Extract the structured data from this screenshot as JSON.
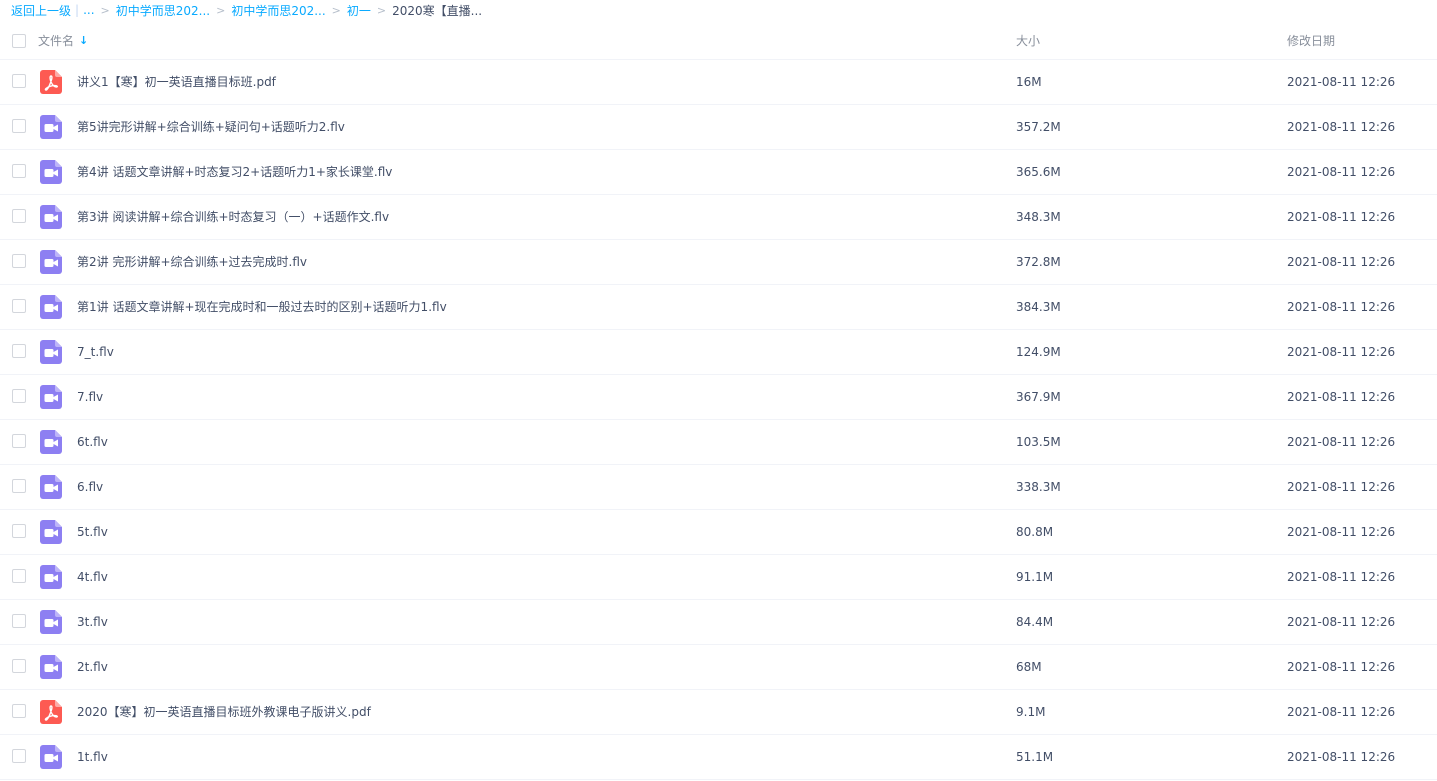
{
  "breadcrumb": {
    "back": "返回上一级",
    "ellipsis": "...",
    "items": [
      "初中学而思202...",
      "初中学而思202...",
      "初一"
    ],
    "current": "2020寒【直播..."
  },
  "header": {
    "name": "文件名",
    "size": "大小",
    "date": "修改日期"
  },
  "colors": {
    "accent": "#09aaff",
    "pdf_icon": "#fd5a52",
    "video_icon": "#8d7ff2"
  },
  "files": [
    {
      "name": "讲义1【寒】初一英语直播目标班.pdf",
      "size": "16M",
      "date": "2021-08-11 12:26",
      "icon": "pdf-icon"
    },
    {
      "name": "第5讲完形讲解+综合训练+疑问句+话题听力2.flv",
      "size": "357.2M",
      "date": "2021-08-11 12:26",
      "icon": "video-icon"
    },
    {
      "name": "第4讲 话题文章讲解+时态复习2+话题听力1+家长课堂.flv",
      "size": "365.6M",
      "date": "2021-08-11 12:26",
      "icon": "video-icon"
    },
    {
      "name": "第3讲 阅读讲解+综合训练+时态复习（一）+话题作文.flv",
      "size": "348.3M",
      "date": "2021-08-11 12:26",
      "icon": "video-icon"
    },
    {
      "name": "第2讲 完形讲解+综合训练+过去完成时.flv",
      "size": "372.8M",
      "date": "2021-08-11 12:26",
      "icon": "video-icon"
    },
    {
      "name": "第1讲 话题文章讲解+现在完成时和一般过去时的区别+话题听力1.flv",
      "size": "384.3M",
      "date": "2021-08-11 12:26",
      "icon": "video-icon"
    },
    {
      "name": "7_t.flv",
      "size": "124.9M",
      "date": "2021-08-11 12:26",
      "icon": "video-icon"
    },
    {
      "name": "7.flv",
      "size": "367.9M",
      "date": "2021-08-11 12:26",
      "icon": "video-icon"
    },
    {
      "name": "6t.flv",
      "size": "103.5M",
      "date": "2021-08-11 12:26",
      "icon": "video-icon"
    },
    {
      "name": "6.flv",
      "size": "338.3M",
      "date": "2021-08-11 12:26",
      "icon": "video-icon"
    },
    {
      "name": "5t.flv",
      "size": "80.8M",
      "date": "2021-08-11 12:26",
      "icon": "video-icon"
    },
    {
      "name": "4t.flv",
      "size": "91.1M",
      "date": "2021-08-11 12:26",
      "icon": "video-icon"
    },
    {
      "name": "3t.flv",
      "size": "84.4M",
      "date": "2021-08-11 12:26",
      "icon": "video-icon"
    },
    {
      "name": "2t.flv",
      "size": "68M",
      "date": "2021-08-11 12:26",
      "icon": "video-icon"
    },
    {
      "name": "2020【寒】初一英语直播目标班外教课电子版讲义.pdf",
      "size": "9.1M",
      "date": "2021-08-11 12:26",
      "icon": "pdf-icon"
    },
    {
      "name": "1t.flv",
      "size": "51.1M",
      "date": "2021-08-11 12:26",
      "icon": "video-icon"
    }
  ]
}
